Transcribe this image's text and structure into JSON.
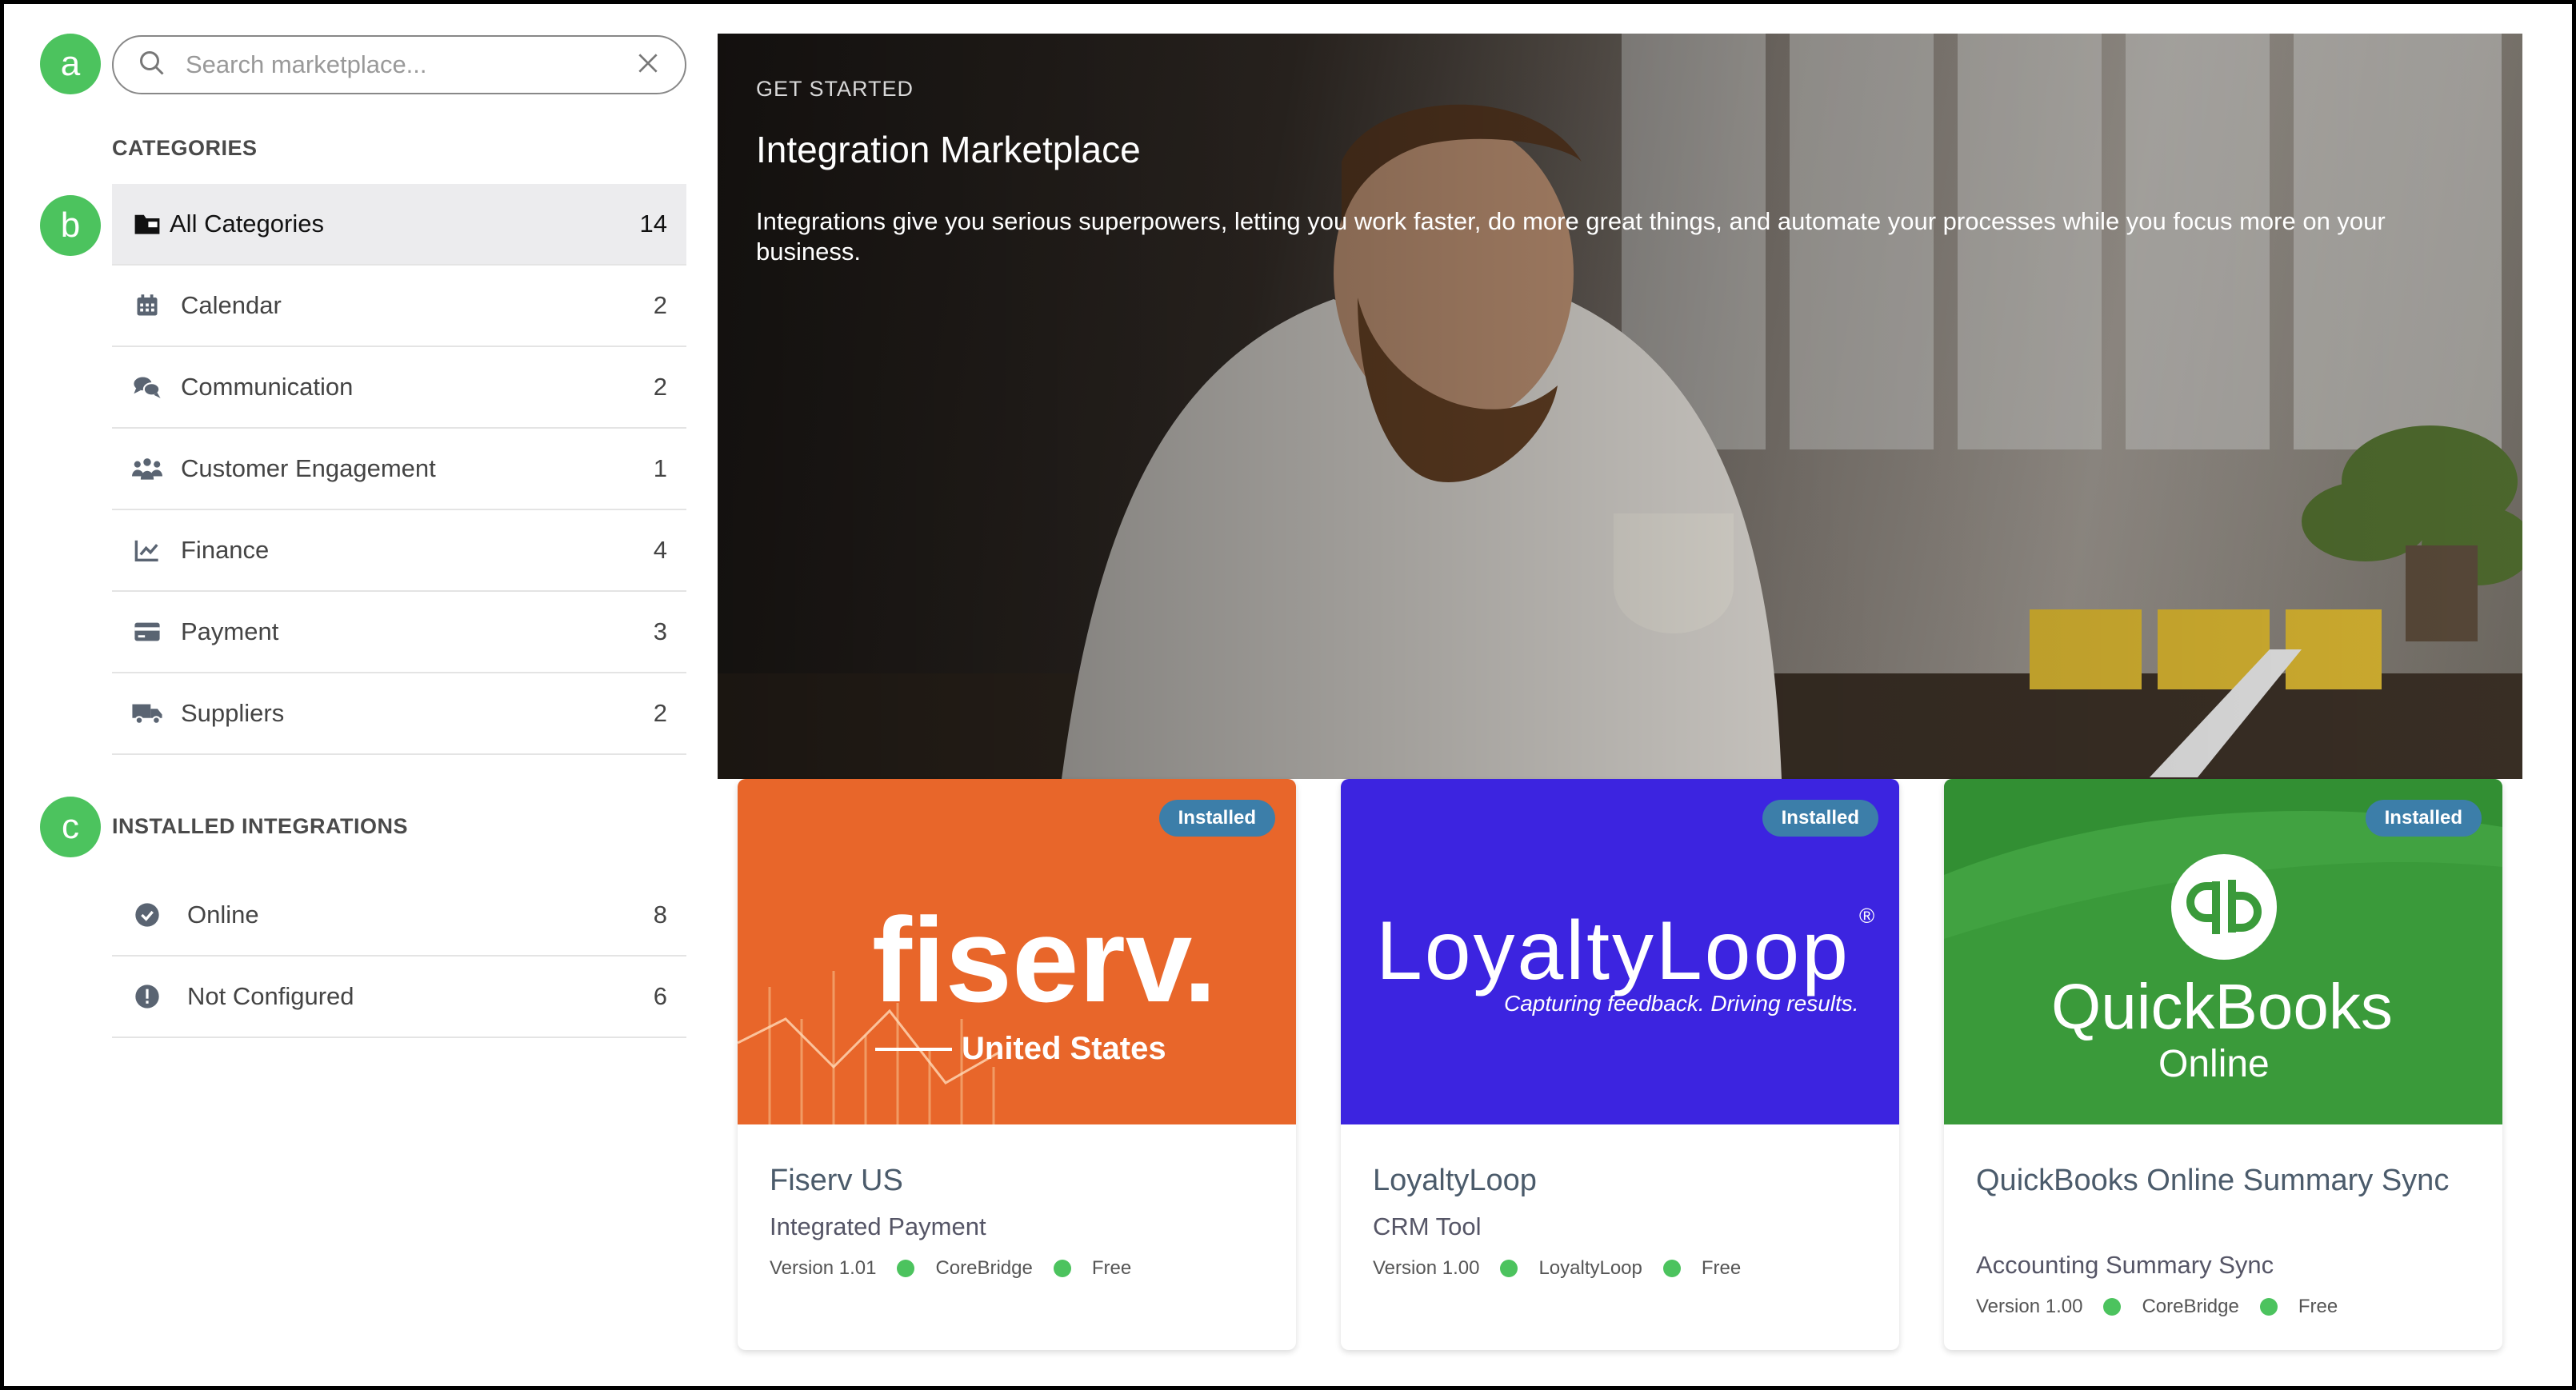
{
  "markers": {
    "a": "a",
    "b": "b",
    "c": "c"
  },
  "search": {
    "placeholder": "Search marketplace...",
    "icon": "search-icon",
    "clear_icon": "close-icon"
  },
  "categories": {
    "title": "CATEGORIES",
    "items": [
      {
        "label": "All Categories",
        "count": "14",
        "icon": "folder-icon"
      },
      {
        "label": "Calendar",
        "count": "2",
        "icon": "calendar-icon"
      },
      {
        "label": "Communication",
        "count": "2",
        "icon": "chat-icon"
      },
      {
        "label": "Customer Engagement",
        "count": "1",
        "icon": "users-icon"
      },
      {
        "label": "Finance",
        "count": "4",
        "icon": "chart-line-icon"
      },
      {
        "label": "Payment",
        "count": "3",
        "icon": "credit-card-icon"
      },
      {
        "label": "Suppliers",
        "count": "2",
        "icon": "truck-icon"
      }
    ]
  },
  "installed": {
    "title": "INSTALLED INTEGRATIONS",
    "items": [
      {
        "label": "Online",
        "count": "8",
        "icon": "check-circle-icon"
      },
      {
        "label": "Not Configured",
        "count": "6",
        "icon": "alert-circle-icon"
      }
    ]
  },
  "hero": {
    "kicker": "GET STARTED",
    "title": "Integration Marketplace",
    "description": "Integrations give you serious superpowers, letting you work faster, do more great things, and automate your processes while you focus more on your business."
  },
  "cards": [
    {
      "badge": "Installed",
      "name": "Fiserv US",
      "subtitle": "Integrated Payment",
      "version": "Version 1.01",
      "vendor": "CoreBridge",
      "price": "Free",
      "logo_text": "fiserv.",
      "logo_sub": "United States",
      "color": "#e8662a"
    },
    {
      "badge": "Installed",
      "name": "LoyaltyLoop",
      "subtitle": "CRM Tool",
      "version": "Version 1.00",
      "vendor": "LoyaltyLoop",
      "price": "Free",
      "logo_text": "LoyaltyLoop",
      "logo_sub": "Capturing feedback. Driving results.",
      "color": "#3c24e0"
    },
    {
      "badge": "Installed",
      "name": "QuickBooks Online Summary Sync",
      "subtitle": "Accounting Summary Sync",
      "version": "Version 1.00",
      "vendor": "CoreBridge",
      "price": "Free",
      "logo_text": "QuickBooks",
      "logo_sub": "Online",
      "color": "#3a9a3a"
    }
  ],
  "colors": {
    "accent_green": "#4cc35e",
    "badge_blue": "#3c7ea9"
  }
}
